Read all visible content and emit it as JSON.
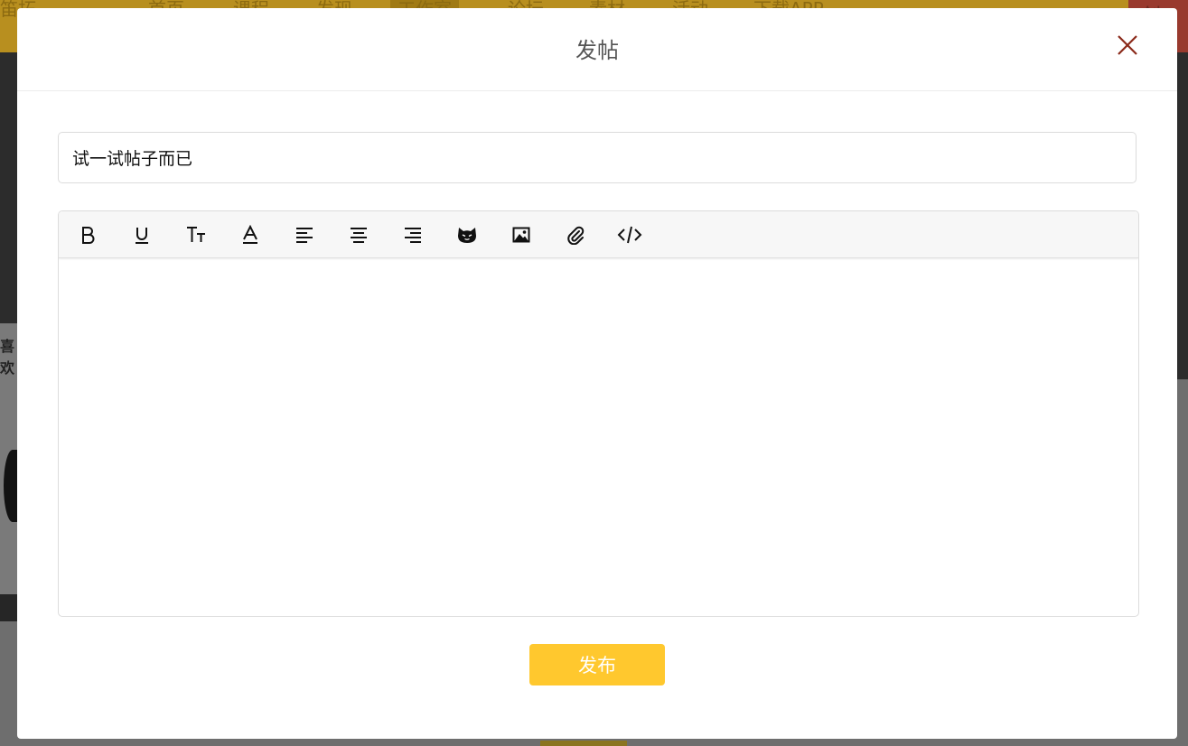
{
  "background": {
    "nav_items": [
      "首页",
      "课程",
      "发现",
      "工作室",
      "论坛",
      "素材",
      "活动",
      "下载APP"
    ],
    "side_text": "喜欢"
  },
  "modal": {
    "title": "发帖",
    "close_icon": "close-icon",
    "title_input": {
      "value": "试一试帖子而已",
      "placeholder": ""
    },
    "toolbar": [
      {
        "name": "bold-icon",
        "tooltip": "B"
      },
      {
        "name": "underline-icon",
        "tooltip": "U"
      },
      {
        "name": "font-size-icon",
        "tooltip": "Tt"
      },
      {
        "name": "font-color-icon",
        "tooltip": "A"
      },
      {
        "name": "align-left-icon"
      },
      {
        "name": "align-center-icon"
      },
      {
        "name": "align-right-icon"
      },
      {
        "name": "emoji-icon"
      },
      {
        "name": "image-icon"
      },
      {
        "name": "attachment-icon"
      },
      {
        "name": "code-icon"
      }
    ],
    "editor_content": "",
    "publish_label": "发布"
  },
  "colors": {
    "accent": "#ffc82e",
    "close": "#8b2a1a",
    "title": "#555555"
  }
}
